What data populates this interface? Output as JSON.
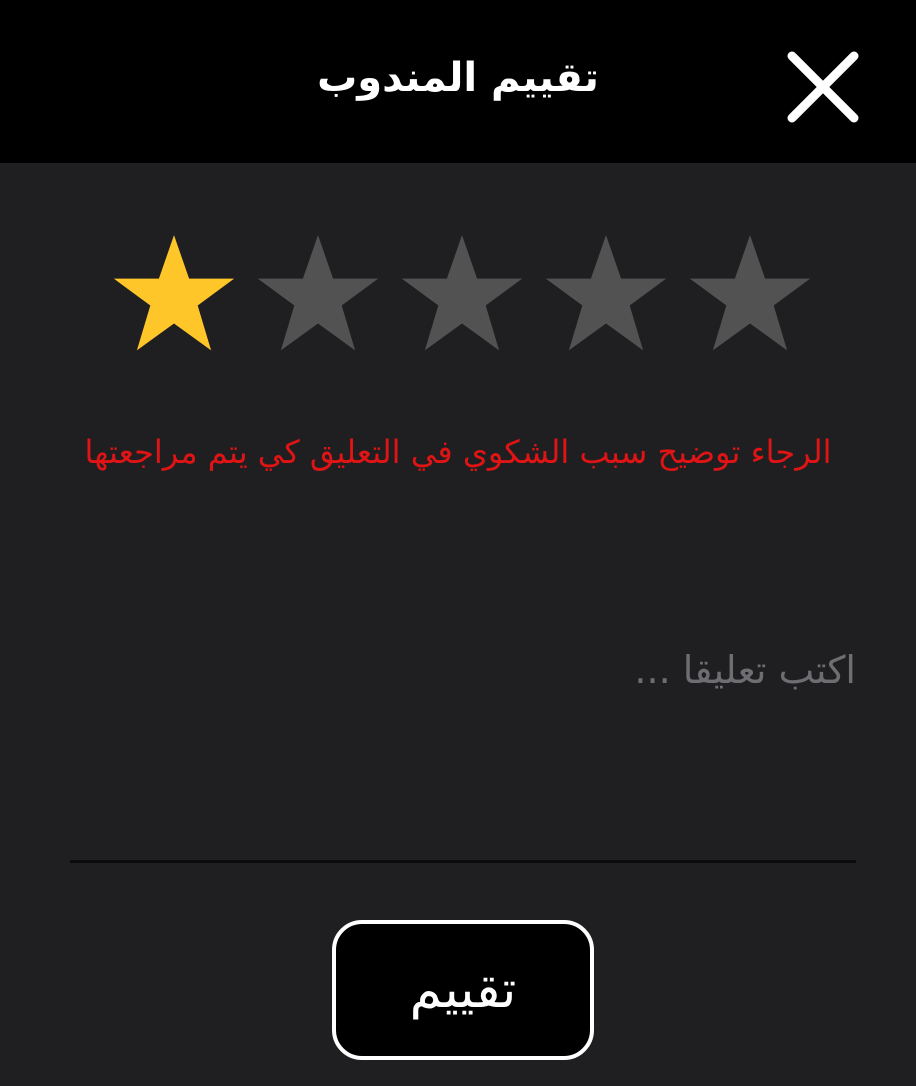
{
  "header": {
    "title": "تقييم المندوب",
    "close_icon": "close-icon"
  },
  "rating": {
    "value": 1,
    "max": 5,
    "filled_color": "#ffc629",
    "empty_color": "#525252",
    "star_icon": "star-icon"
  },
  "hint": {
    "text": "الرجاء توضيح سبب الشكوي في التعليق كي يتم مراجعتها",
    "color": "#e01414"
  },
  "comment": {
    "value": "",
    "placeholder": "اكتب تعليقا ..."
  },
  "submit": {
    "label": "تقييم"
  }
}
